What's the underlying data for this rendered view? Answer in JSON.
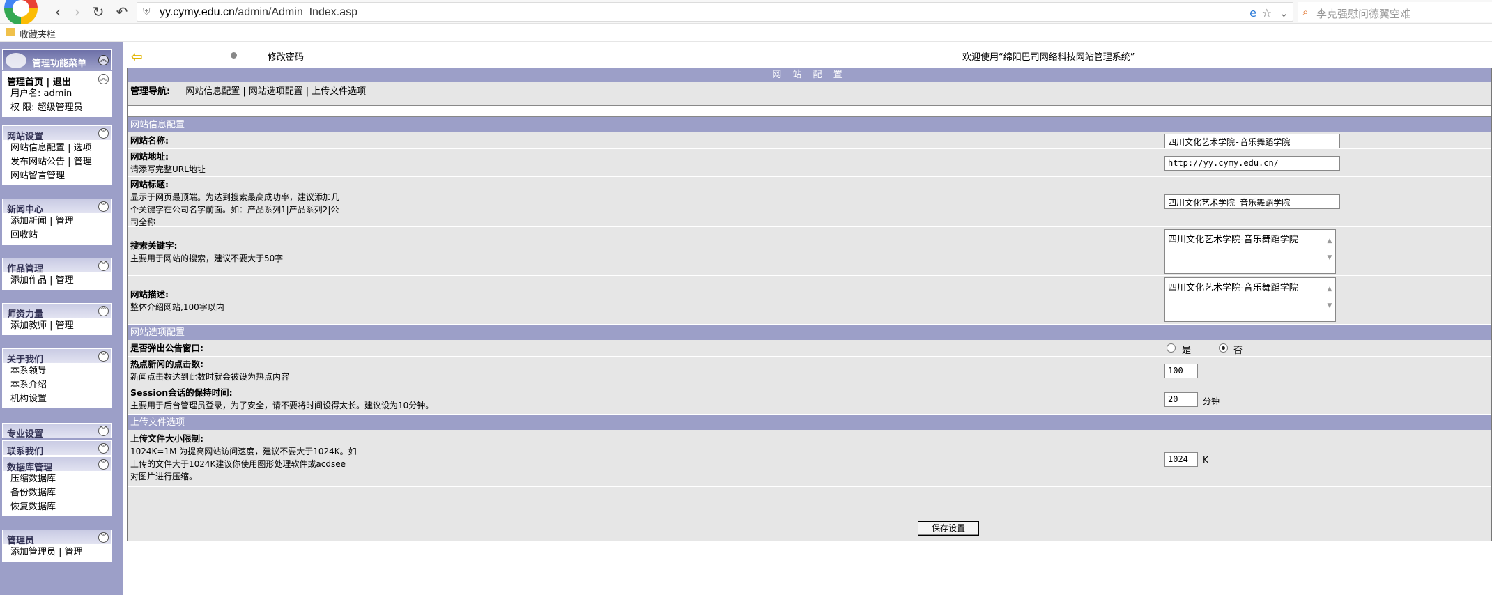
{
  "browser": {
    "url_host": "yy.cymy.edu.cn",
    "url_path": "/admin/Admin_Index.asp",
    "search_placeholder": "李克强慰问德翼空难",
    "favorites_label": "收藏夹栏"
  },
  "sidebar": {
    "title": "管理功能菜单",
    "home": {
      "home_label": "管理首页",
      "sep": "|",
      "logout_label": "退出",
      "user_line": "用户名: admin",
      "perm_line": "权  限: 超级管理员"
    },
    "groups": [
      {
        "title": "网站设置",
        "items": [
          [
            "网站信息配置",
            "选项"
          ],
          [
            "发布网站公告",
            "管理"
          ],
          [
            "网站留言管理"
          ]
        ]
      },
      {
        "title": "新闻中心",
        "items": [
          [
            "添加新闻",
            "管理"
          ],
          [
            "回收站"
          ]
        ]
      },
      {
        "title": "作品管理",
        "items": [
          [
            "添加作品",
            "管理"
          ]
        ]
      },
      {
        "title": "师资力量",
        "items": [
          [
            "添加教师",
            "管理"
          ]
        ]
      },
      {
        "title": "关于我们",
        "items": [
          [
            "本系领导"
          ],
          [
            "本系介绍"
          ],
          [
            "机构设置"
          ]
        ]
      },
      {
        "title": "专业设置",
        "items": []
      },
      {
        "title": "联系我们",
        "items": []
      },
      {
        "title": "数据库管理",
        "items": [
          [
            "压缩数据库"
          ],
          [
            "备份数据库"
          ],
          [
            "恢复数据库"
          ]
        ]
      },
      {
        "title": "管理员",
        "items": [
          [
            "添加管理员",
            "管理"
          ]
        ]
      }
    ]
  },
  "topbar": {
    "change_password": "修改密码",
    "welcome": "欢迎使用“绵阳巴司网络科技网站管理系统”"
  },
  "panel": {
    "title": "网 站 配 置",
    "nav_label": "管理导航:",
    "nav_links": [
      "网站信息配置",
      "网站选项配置",
      "上传文件选项"
    ],
    "sections": {
      "info": "网站信息配置",
      "options": "网站选项配置",
      "upload": "上传文件选项"
    },
    "fields": {
      "site_name": {
        "label": "网站名称:",
        "value": "四川文化艺术学院-音乐舞蹈学院"
      },
      "site_url": {
        "label": "网站地址:",
        "hint": "请添写完整URL地址",
        "value": "http://yy.cymy.edu.cn/"
      },
      "site_title": {
        "label": "网站标题:",
        "hint_lines": [
          "显示于网页最顶端。为达到搜索最高成功率，建议添加几",
          "个关键字在公司名字前面。如：产品系列1|产品系列2|公",
          "司全称"
        ],
        "value": "四川文化艺术学院-音乐舞蹈学院"
      },
      "keywords": {
        "label": "搜索关键字:",
        "hint": "主要用于网站的搜索，建议不要大于50字",
        "value": "四川文化艺术学院-音乐舞蹈学院"
      },
      "description": {
        "label": "网站描述:",
        "hint": "整体介绍网站,100字以内",
        "value": "四川文化艺术学院-音乐舞蹈学院"
      },
      "popup": {
        "label": "是否弹出公告窗口:",
        "yes": "是",
        "no": "否",
        "selected": "否"
      },
      "hot_clicks": {
        "label": "热点新闻的点击数:",
        "hint": "新闻点击数达到此数时就会被设为热点内容",
        "value": "100"
      },
      "session": {
        "label": "Session会话的保持时间:",
        "hint": "主要用于后台管理员登录，为了安全，请不要将时间设得太长。建议设为10分钟。",
        "value": "20",
        "unit": "分钟"
      },
      "upload_limit": {
        "label": "上传文件大小限制:",
        "hint_lines": [
          "1024K=1M 为提高网站访问速度，建议不要大于1024K。如",
          "上传的文件大于1024K建议你使用图形处理软件或acdsee",
          "对图片进行压缩。"
        ],
        "value": "1024",
        "unit": "K"
      }
    },
    "save_label": "保存设置"
  }
}
